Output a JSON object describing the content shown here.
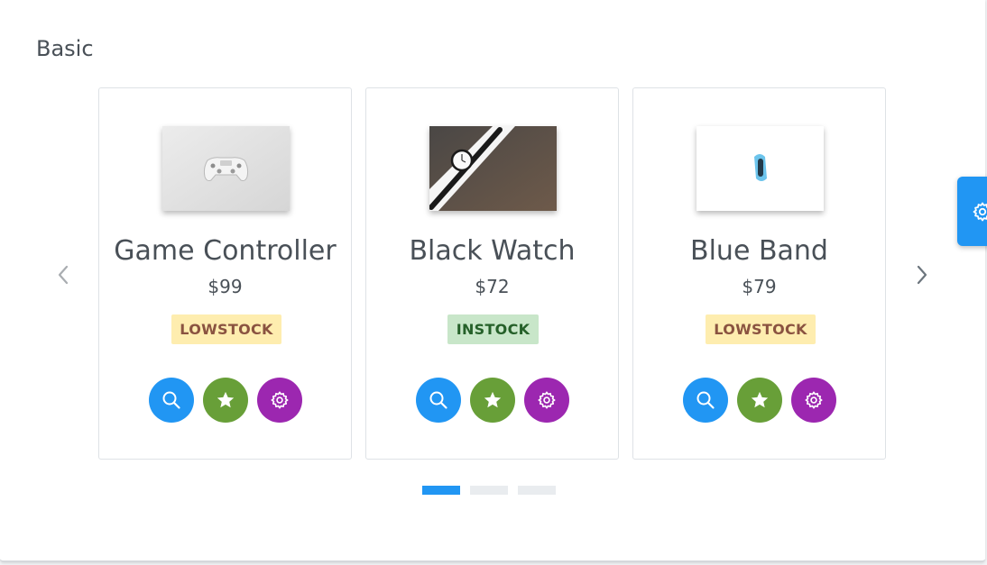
{
  "section": {
    "title": "Basic"
  },
  "products": [
    {
      "name": "Game Controller",
      "price": "$99",
      "status": "LOWSTOCK",
      "image_icon": "game-controller-image"
    },
    {
      "name": "Black Watch",
      "price": "$72",
      "status": "INSTOCK",
      "image_icon": "black-watch-image"
    },
    {
      "name": "Blue Band",
      "price": "$79",
      "status": "LOWSTOCK",
      "image_icon": "blue-band-image"
    }
  ],
  "actions": [
    {
      "icon": "search-icon",
      "color": "#2196f3"
    },
    {
      "icon": "star-icon",
      "color": "#689f38"
    },
    {
      "icon": "gear-icon",
      "color": "#9c27b0"
    }
  ],
  "navigation": {
    "prev_icon": "chevron-left-icon",
    "next_icon": "chevron-right-icon",
    "page_count": 3,
    "active_page": 1
  },
  "status_colors": {
    "LOWSTOCK": {
      "bg": "#feedaf",
      "fg": "#8a5340"
    },
    "INSTOCK": {
      "bg": "#c8e6c9",
      "fg": "#256029"
    }
  },
  "accent": "#2196f3",
  "config_button": {
    "icon": "gear-icon"
  }
}
